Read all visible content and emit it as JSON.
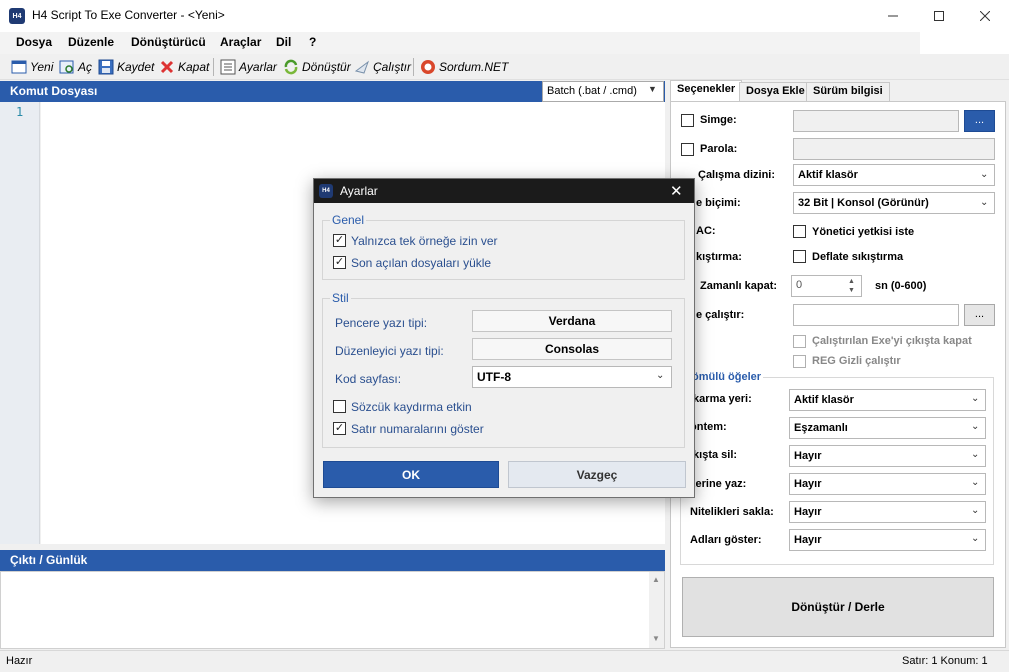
{
  "window": {
    "title": "H4 Script To Exe Converter - <Yeni>",
    "icon_text": "H4"
  },
  "menu": [
    "Dosya",
    "Düzenle",
    "Dönüştürücü",
    "Araçlar",
    "Dil",
    "?"
  ],
  "toolbar": {
    "new": "Yeni",
    "open": "Aç",
    "save": "Kaydet",
    "close": "Kapat",
    "settings": "Ayarlar",
    "convert": "Dönüştür",
    "run": "Çalıştır",
    "sordum": "Sordum.NET"
  },
  "editor": {
    "header": "Komut Dosyası",
    "language": "Batch (.bat / .cmd)",
    "line_number": "1"
  },
  "output": {
    "header": "Çıktı / Günlük"
  },
  "tabs": [
    "Seçenekler",
    "Dosya Ekle",
    "Sürüm bilgisi"
  ],
  "options": {
    "icon_label": "Simge:",
    "icon_browse": "...",
    "password_label": "Parola:",
    "workdir_label": "Çalışma dizini:",
    "workdir_value": "Aktif klasör",
    "format_label": "e biçimi:",
    "format_value": "32 Bit | Konsol (Görünür)",
    "uac_label": "AC:",
    "uac_checkbox": "Yönetici yetkisi iste",
    "compress_label": "kıştırma:",
    "compress_checkbox": "Deflate sıkıştırma",
    "timed_close_label": "Zamanlı kapat:",
    "timed_close_value": "0",
    "timed_close_unit": "sn (0-600)",
    "run_label": "e çalıştır:",
    "run_browse": "...",
    "close_on_exit": "Çalıştırılan Exe'yi çıkışta kapat",
    "reg_hidden": "REG Gizli çalıştır",
    "embedded_title": "ömülü öğeler",
    "extract_label": "ıkarma yeri:",
    "extract_value": "Aktif klasör",
    "method_label": "öntem:",
    "method_value": "Eşzamanlı",
    "delete_label": "ıkışta sil:",
    "delete_value": "Hayır",
    "overwrite_label": "zerine yaz:",
    "overwrite_value": "Hayır",
    "attrs_label": "Nitelikleri sakla:",
    "attrs_value": "Hayır",
    "names_label": "Adları göster:",
    "names_value": "Hayır",
    "compile_button": "Dönüştür / Derle"
  },
  "status": {
    "left": "Hazır",
    "right": "Satır: 1 Konum: 1"
  },
  "dialog": {
    "title": "Ayarlar",
    "icon_text": "H4",
    "general_title": "Genel",
    "single_instance": "Yalnızca tek örneğe izin ver",
    "load_recent": "Son açılan dosyaları yükle",
    "style_title": "Stil",
    "window_font_label": "Pencere yazı tipi:",
    "window_font_value": "Verdana",
    "editor_font_label": "Düzenleyici yazı tipi:",
    "editor_font_value": "Consolas",
    "codepage_label": "Kod sayfası:",
    "codepage_value": "UTF-8",
    "word_wrap": "Sözcük kaydırma etkin",
    "show_line_numbers": "Satır numaralarını göster",
    "ok": "OK",
    "cancel": "Vazgeç"
  }
}
